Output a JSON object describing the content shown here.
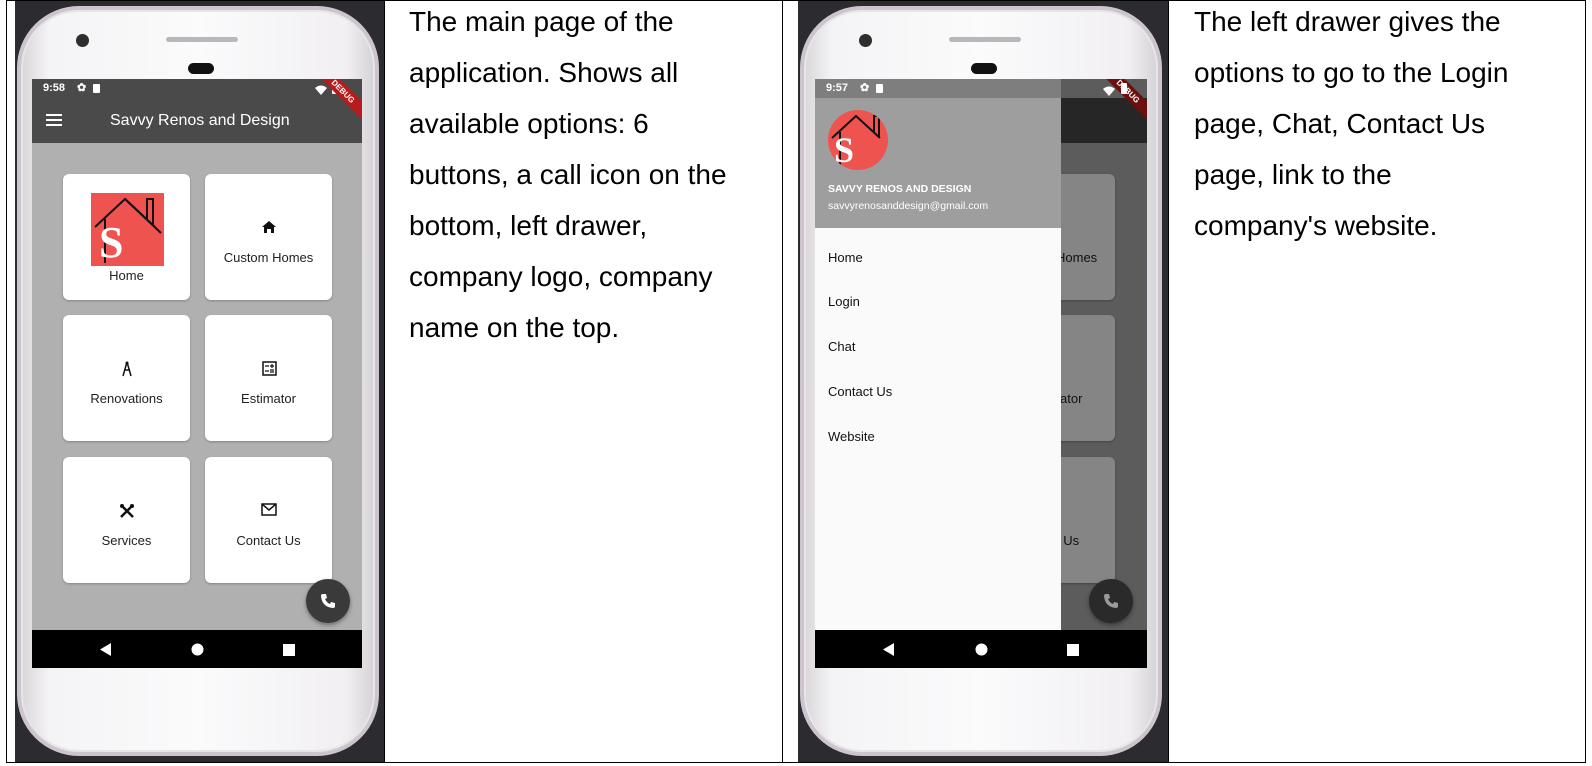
{
  "left_panel": {
    "status_time": "9:58",
    "app_title": "Savvy Renos and Design",
    "debug_banner": "DEBUG",
    "tiles": [
      {
        "label": "Home",
        "icon": "company-logo"
      },
      {
        "label": "Custom Homes",
        "icon": "home-icon"
      },
      {
        "label": "Renovations",
        "icon": "compass-icon"
      },
      {
        "label": "Estimator",
        "icon": "calculator-icon"
      },
      {
        "label": "Services",
        "icon": "tools-icon"
      },
      {
        "label": "Contact Us",
        "icon": "mail-icon"
      }
    ],
    "fab_icon": "phone-icon",
    "description": [
      "The main page of the",
      "application. Shows all",
      "available options: 6",
      "buttons, a call icon on the",
      "bottom, left drawer,",
      "company logo, company",
      "name on the top."
    ]
  },
  "right_panel": {
    "status_time": "9:57",
    "debug_banner": "DEBUG",
    "drawer": {
      "company_name": "SAVVY RENOS AND DESIGN",
      "email": "savvyrenosanddesign@gmail.com",
      "items": [
        "Home",
        "Login",
        "Chat",
        "Contact Us",
        "Website"
      ]
    },
    "behind_fragments": {
      "title_fragment": "n",
      "tile1": "Homes",
      "tile2": "ator",
      "tile3": "t Us"
    },
    "fab_icon": "phone-icon",
    "description": [
      "The left drawer gives the",
      "options to go to the Login",
      "page, Chat, Contact Us",
      "page, link to the",
      "company's website."
    ]
  },
  "colors": {
    "appbar": "#4a4a4a",
    "screen_bg": "#b0b0b0",
    "logo_red": "#ef5350",
    "drawer_header": "#9e9e9e"
  }
}
